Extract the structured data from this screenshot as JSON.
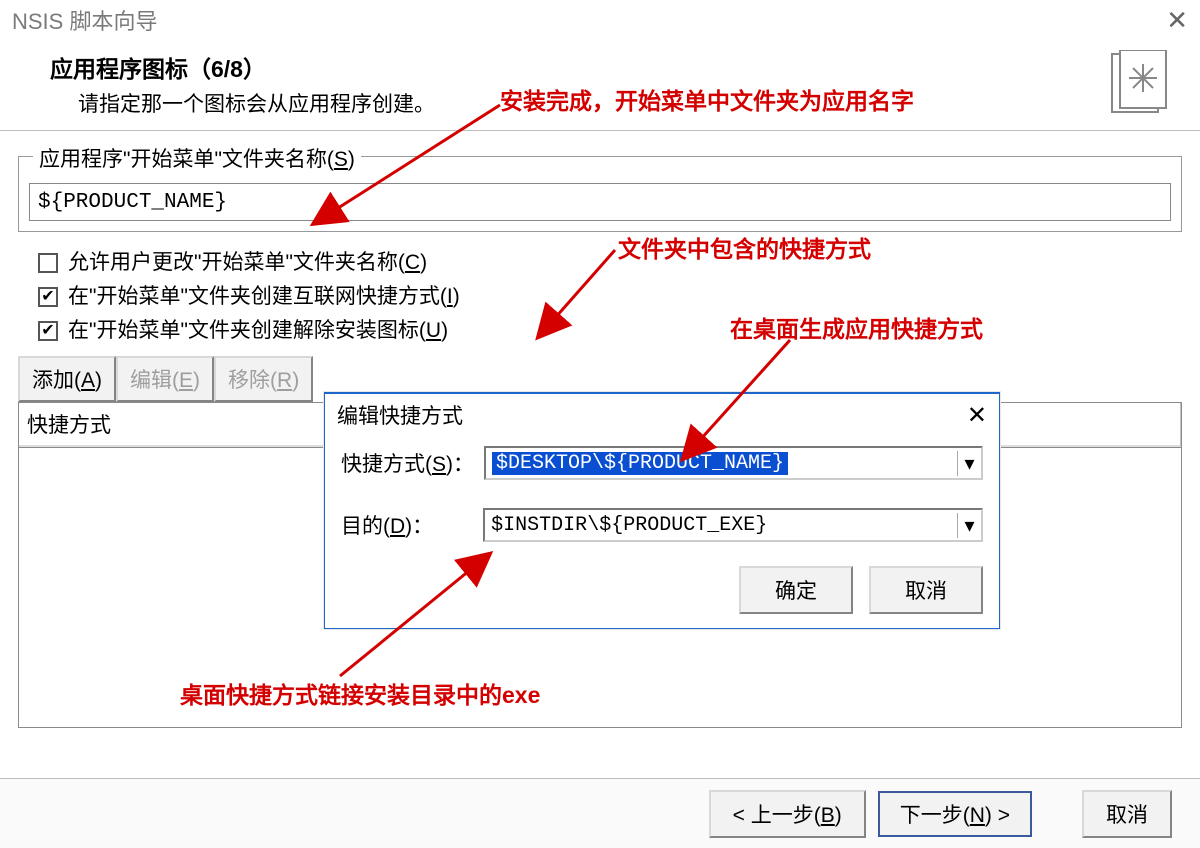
{
  "titlebar": {
    "title": "NSIS 脚本向导",
    "close": "✕"
  },
  "header": {
    "title": "应用程序图标（6/8）",
    "subtitle": "请指定那一个图标会从应用程序创建。"
  },
  "group": {
    "legend_pre": "应用程序\"开始菜单\"文件夹名称(",
    "legend_key": "S",
    "legend_post": ")",
    "value": "${PRODUCT_NAME}"
  },
  "checks": {
    "c1": {
      "checked": false,
      "pre": "允许用户更改\"开始菜单\"文件夹名称(",
      "key": "C",
      "post": ")"
    },
    "c2": {
      "checked": true,
      "pre": "在\"开始菜单\"文件夹创建互联网快捷方式(",
      "key": "I",
      "post": ")"
    },
    "c3": {
      "checked": true,
      "pre": "在\"开始菜单\"文件夹创建解除安装图标(",
      "key": "U",
      "post": ")"
    }
  },
  "tabs": {
    "add": {
      "pre": "添加(",
      "key": "A",
      "post": ")"
    },
    "edit": {
      "pre": "编辑(",
      "key": "E",
      "post": ")"
    },
    "remove": {
      "pre": "移除(",
      "key": "R",
      "post": ")"
    }
  },
  "list": {
    "colhead": "快捷方式"
  },
  "modal": {
    "title": "编辑快捷方式",
    "close": "✕",
    "row1": {
      "pre": "快捷方式(",
      "key": "S",
      "post": ")：",
      "value": "$DESKTOP\\${PRODUCT_NAME}",
      "dd": "▾"
    },
    "row2": {
      "pre": "目的(",
      "key": "D",
      "post": ")：",
      "value": "$INSTDIR\\${PRODUCT_EXE}",
      "dd": "▾"
    },
    "ok": "确定",
    "cancel": "取消"
  },
  "bottom": {
    "back": {
      "pre": "< 上一步(",
      "key": "B",
      "post": ")"
    },
    "next": {
      "pre": "下一步(",
      "key": "N",
      "post": ") >"
    },
    "cancel": "取消"
  },
  "anno": {
    "a1": "安装完成，开始菜单中文件夹为应用名字",
    "a2": "文件夹中包含的快捷方式",
    "a3": "在桌面生成应用快捷方式",
    "a4": "桌面快捷方式链接安装目录中的exe"
  }
}
